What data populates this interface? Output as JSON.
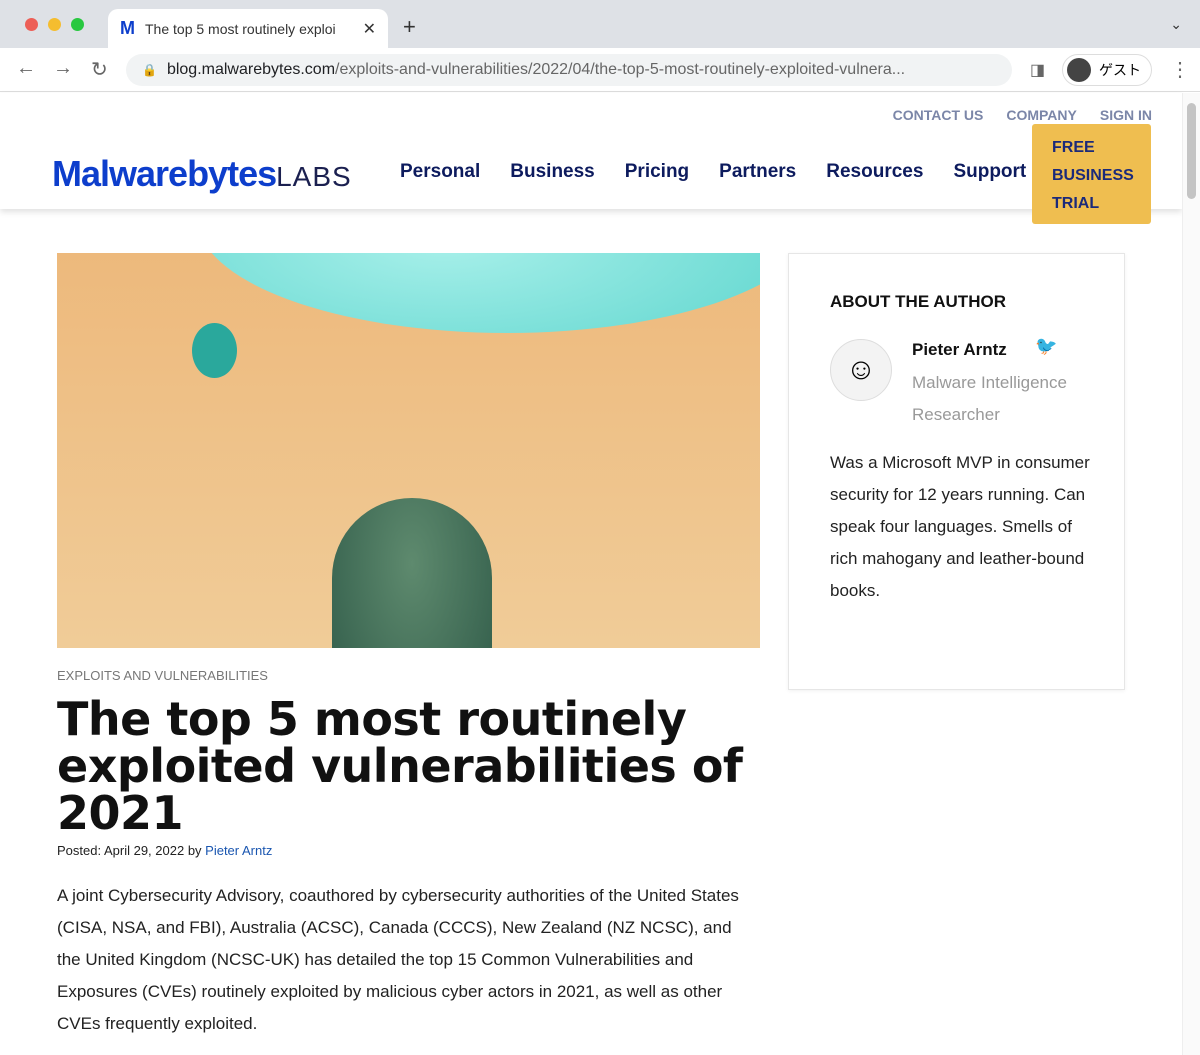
{
  "browser": {
    "tab_title": "The top 5 most routinely exploi",
    "url_domain": "blog.malwarebytes.com",
    "url_path": "/exploits-and-vulnerabilities/2022/04/the-top-5-most-routinely-exploited-vulnera...",
    "profile_label": "ゲスト"
  },
  "header": {
    "top_links": [
      "CONTACT US",
      "COMPANY",
      "SIGN IN"
    ],
    "logo_main": "Malwarebytes",
    "logo_sub": "LABS",
    "nav": [
      "Personal",
      "Business",
      "Pricing",
      "Partners",
      "Resources",
      "Support"
    ],
    "cta": "FREE BUSINESS TRIAL",
    "cta_color": "#efbe50"
  },
  "article": {
    "category": "EXPLOITS AND VULNERABILITIES",
    "title": "The top 5 most routinely exploited vulnerabilities of 2021",
    "posted_prefix": "Posted: April 29, 2022 by ",
    "author_link": "Pieter Arntz",
    "body": "A joint Cybersecurity Advisory, coauthored by cybersecurity authorities of the United States (CISA, NSA, and FBI), Australia (ACSC), Canada (CCCS), New Zealand (NZ NCSC), and the United Kingdom (NCSC-UK) has detailed the top 15 Common Vulnerabilities and Exposures (CVEs) routinely exploited by malicious cyber actors in 2021, as well as other CVEs frequently exploited."
  },
  "author": {
    "heading": "ABOUT THE AUTHOR",
    "name": "Pieter Arntz",
    "role": "Malware Intelligence Researcher",
    "bio": "Was a Microsoft MVP in consumer security for 12 years running. Can speak four languages. Smells of rich mahogany and leather-bound books.",
    "social_icon": "twitter-icon"
  }
}
